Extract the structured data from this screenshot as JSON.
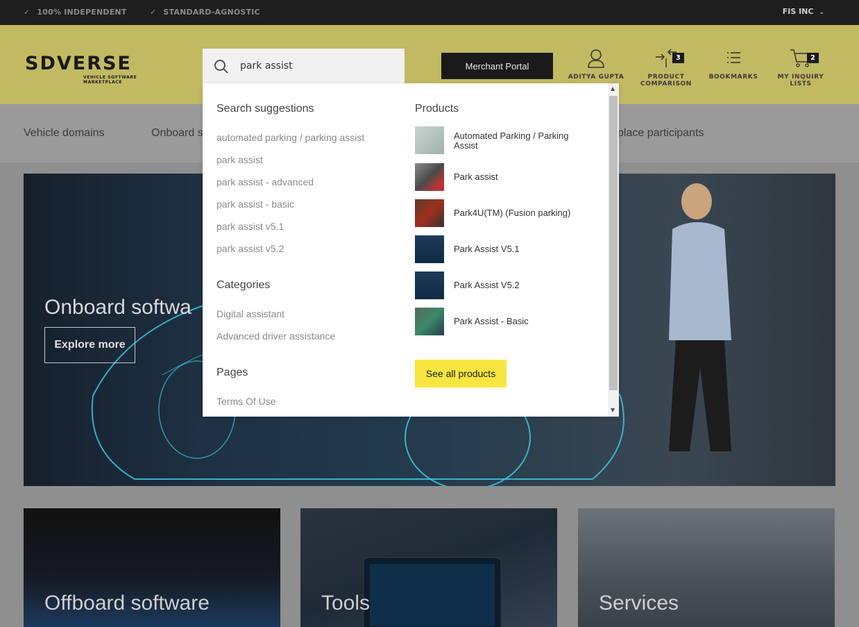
{
  "topbar": {
    "claims": [
      "100% INDEPENDENT",
      "STANDARD-AGNOSTIC"
    ],
    "company": "FIS INC"
  },
  "logo": {
    "wordmark": "SDVERSE",
    "tagline": "VEHICLE SOFTWARE MARKETPLACE"
  },
  "search": {
    "value": "park assist",
    "placeholder": ""
  },
  "header": {
    "merchant_portal": "Merchant Portal",
    "user": "ADITYA GUPTA",
    "comparison_line1": "PRODUCT",
    "comparison_line2": "COMPARISON",
    "comparison_count": "3",
    "bookmarks": "BOOKMARKS",
    "inquiry_line1": "MY INQUIRY",
    "inquiry_line2": "LISTS",
    "inquiry_count": "2"
  },
  "nav": {
    "items": [
      "Vehicle domains",
      "Onboard s",
      "place participants"
    ]
  },
  "hero": {
    "title": "Onboard softwa",
    "button": "Explore more"
  },
  "cards": [
    "Offboard software",
    "Tools",
    "Services"
  ],
  "dropdown": {
    "suggestions_heading": "Search suggestions",
    "suggestions": [
      "automated parking / parking assist",
      "park assist",
      "park assist - advanced",
      "park assist - basic",
      "park assist v5.1",
      "park assist v5.2"
    ],
    "categories_heading": "Categories",
    "categories": [
      "Digital assistant",
      "Advanced driver assistance"
    ],
    "pages_heading": "Pages",
    "pages": [
      "Terms Of Use"
    ],
    "products_heading": "Products",
    "products": [
      {
        "line1": "Automated Parking / Parking",
        "line2": "Assist"
      },
      {
        "line1": "Park assist",
        "line2": ""
      },
      {
        "line1": "Park4U(TM) (Fusion parking)",
        "line2": ""
      },
      {
        "line1": "Park Assist V5.1",
        "line2": ""
      },
      {
        "line1": "Park Assist V5.2",
        "line2": ""
      },
      {
        "line1": "Park Assist - Basic",
        "line2": ""
      }
    ],
    "see_all": "See all products"
  },
  "colors": {
    "header_bg": "#c2b963",
    "topbar_bg": "#1e1e1e",
    "accent_yellow": "#f7e63f"
  }
}
